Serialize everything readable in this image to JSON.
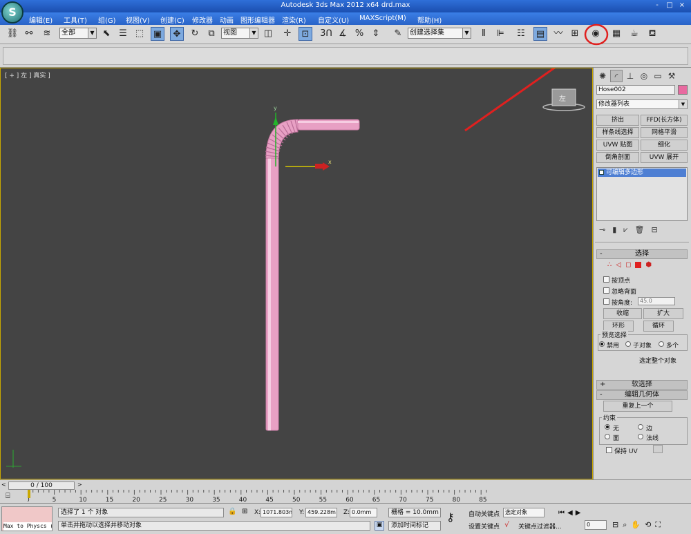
{
  "window": {
    "title": "Autodesk 3ds Max  2012 x64     drd.max",
    "controls": [
      "-",
      "□",
      "×"
    ]
  },
  "menu": [
    "编辑(E)",
    "工具(T)",
    "组(G)",
    "视图(V)",
    "创建(C)",
    "修改器",
    "动画",
    "图形编辑器",
    "渲染(R)",
    "自定义(U)",
    "MAXScript(M)",
    "帮助(H)"
  ],
  "toolbar": {
    "selection_filter": "全部",
    "reference_coord": "视图",
    "snap_3": "3",
    "percent_snap": "%",
    "named_selection": "创建选择集",
    "highlighted_tool": "material-editor-icon"
  },
  "viewport": {
    "label": "[ + ] 左 ] 真实 ]",
    "viewcube_label": "左",
    "gizmo_y": "y",
    "gizmo_x": "x",
    "hose_color": "#e8a0c4",
    "background_color": "#444444"
  },
  "annotation": {
    "color": "#e0201f",
    "points_to": "material-editor-icon"
  },
  "command_panel": {
    "object_name": "Hose002",
    "object_color": "#e86aa0",
    "modifier_list": "修改器列表",
    "modifier_buttons": [
      "挤出",
      "FFD(长方体)",
      "样条线选择",
      "网格平滑",
      "UVW 贴图",
      "细化",
      "倒角剖面",
      "UVW 展开"
    ],
    "stack_item": "可编辑多边形",
    "selection": {
      "header": "选择",
      "by_vertex": "按顶点",
      "ignore_backfacing": "忽略背面",
      "by_angle": "按角度:",
      "angle_value": "45.0",
      "shrink": "收缩",
      "grow": "扩大",
      "ring": "环形",
      "loop": "循环",
      "preview_title": "预览选择",
      "preview_disable": "禁用",
      "preview_subobj": "子对象",
      "preview_multi": "多个",
      "whole_object": "选定整个对象"
    },
    "soft_selection": "软选择",
    "edit_geometry": {
      "header": "编辑几何体",
      "repeat_last": "重复上一个",
      "constraints_title": "约束",
      "none": "无",
      "edge": "边",
      "face": "面",
      "normal": "法线",
      "preserve_uv": "保持 UV"
    }
  },
  "timeline": {
    "frame_display": "0 / 100",
    "ticks": [
      "0",
      "5",
      "10",
      "15",
      "20",
      "25",
      "30",
      "35",
      "40",
      "45",
      "50",
      "55",
      "60",
      "65",
      "70",
      "75",
      "80",
      "85"
    ]
  },
  "status": {
    "maxscript_line": "Max to Physcs (",
    "selected": "选择了 1 个 对象",
    "prompt": "单击并拖动以选择并移动对象",
    "x_label": "X:",
    "x_value": "1071.803m",
    "y_label": "Y:",
    "y_value": "459.228m",
    "z_label": "Z:",
    "z_value": "0.0mm",
    "grid": "栅格 = 10.0mm",
    "add_time_tag": "添加时间标记",
    "auto_key": "自动关键点",
    "selected_obj": "选定对象",
    "set_key": "设置关键点",
    "key_filters": "关键点过滤器...",
    "frame_field": "0"
  }
}
